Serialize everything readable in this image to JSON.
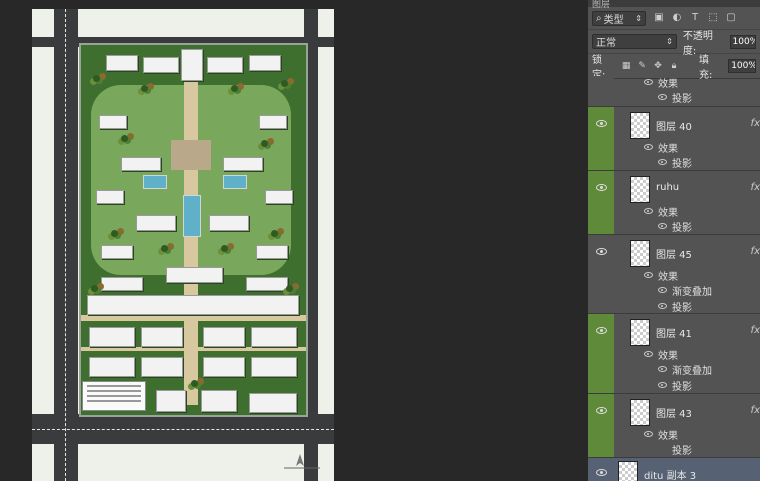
{
  "canvas": {
    "document": "site plan rendering"
  },
  "panel": {
    "tab_title": "图层",
    "filter": {
      "label": "类型",
      "search_icon": "search-icon"
    },
    "blend_mode": "正常",
    "opacity_label": "不透明度:",
    "opacity_value": "100%",
    "lock_label": "锁定:",
    "fill_label": "填充:",
    "fill_value": "100%"
  },
  "layers": [
    {
      "name": "",
      "effects_label": "效果",
      "effects": [
        "投影"
      ],
      "partial": true
    },
    {
      "name": "图层 40",
      "fx": "fx",
      "effects_label": "效果",
      "effects": [
        "投影"
      ]
    },
    {
      "name": "ruhu",
      "fx": "fx",
      "effects_label": "效果",
      "effects": [
        "投影"
      ]
    },
    {
      "name": "图层 45",
      "fx": "fx",
      "effects_label": "效果",
      "effects": [
        "渐变叠加",
        "投影"
      ]
    },
    {
      "name": "图层 41",
      "fx": "fx",
      "effects_label": "效果",
      "effects": [
        "渐变叠加",
        "投影"
      ]
    },
    {
      "name": "图层 43",
      "fx": "fx",
      "effects_label": "效果",
      "effects": [
        "投影"
      ]
    },
    {
      "name": "ditu 副本 3",
      "fx": "",
      "effects_label": "",
      "effects": []
    }
  ],
  "colors": {
    "accent_eye_column": "#5e8a3a",
    "panel_bg": "#535353",
    "selected_row": "#566173"
  }
}
